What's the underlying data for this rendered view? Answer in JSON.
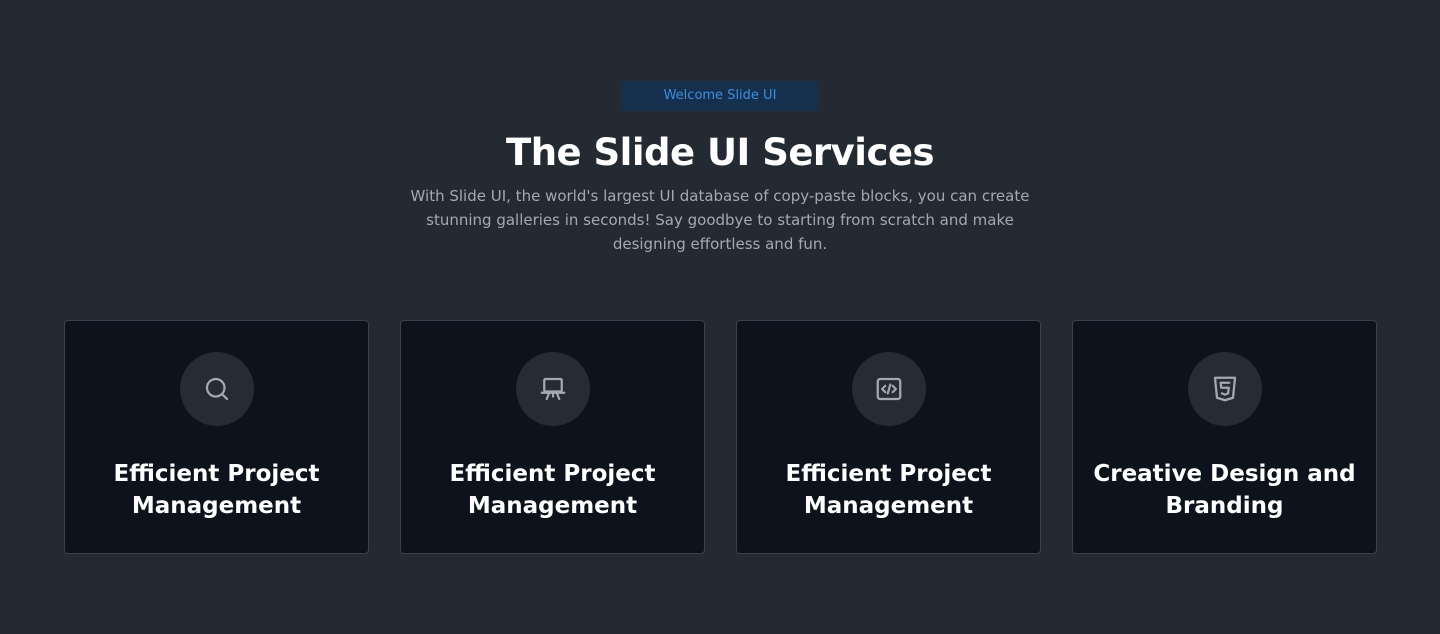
{
  "header": {
    "badge": "Welcome Slide UI",
    "title": "The Slide UI Services",
    "subtitle": "With Slide UI, the world's largest UI database of copy-paste blocks, you can create stunning galleries in seconds! Say goodbye to starting from scratch and make designing effortless and fun."
  },
  "cards": [
    {
      "title": "Efficient Project Management",
      "icon": "search-icon"
    },
    {
      "title": "Efficient Project Management",
      "icon": "presentation-icon"
    },
    {
      "title": "Efficient Project Management",
      "icon": "code-icon"
    },
    {
      "title": "Creative Design and Branding",
      "icon": "html5-icon"
    }
  ],
  "colors": {
    "background": "#242a31",
    "card_background": "#0d131c",
    "badge_background": "#15304f",
    "badge_text": "#3e8ddd",
    "icon_circle": "#262c34"
  }
}
